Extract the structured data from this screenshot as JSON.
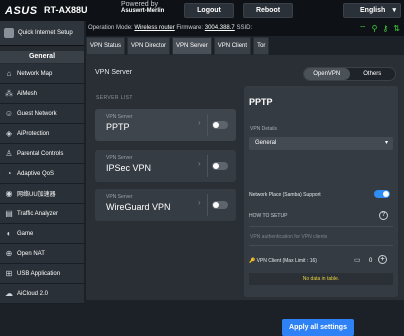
{
  "header": {
    "brand": "ASUS",
    "model": "RT-AX88U",
    "powered_by_label": "Powered by",
    "powered_by_brand": "Asuswrt-Merlin",
    "logout_label": "Logout",
    "reboot_label": "Reboot",
    "language": "English"
  },
  "opbar": {
    "mode_label": "Operation Mode:",
    "mode_value": "Wireless router",
    "firmware_label": "Firmware:",
    "firmware_value": "3004.388.7",
    "ssid_label": "SSID:"
  },
  "sidebar": {
    "qis_label": "Quick Internet Setup",
    "general_label": "General",
    "items": [
      {
        "label": "Network Map",
        "icon": "network-map-icon"
      },
      {
        "label": "AiMesh",
        "icon": "aimesh-icon"
      },
      {
        "label": "Guest Network",
        "icon": "guest-network-icon"
      },
      {
        "label": "AiProtection",
        "icon": "aiprotection-icon"
      },
      {
        "label": "Parental Controls",
        "icon": "parental-controls-icon"
      },
      {
        "label": "Adaptive QoS",
        "icon": "adaptive-qos-icon"
      },
      {
        "label": "网络UU加速器",
        "icon": "uu-accelerator-icon"
      },
      {
        "label": "Traffic Analyzer",
        "icon": "traffic-analyzer-icon"
      },
      {
        "label": "Game",
        "icon": "game-icon"
      },
      {
        "label": "Open NAT",
        "icon": "open-nat-icon"
      },
      {
        "label": "USB Application",
        "icon": "usb-application-icon"
      },
      {
        "label": "AiCloud 2.0",
        "icon": "aicloud-icon"
      }
    ]
  },
  "tabs": [
    {
      "label": "VPN Status"
    },
    {
      "label": "VPN Director"
    },
    {
      "label": "VPN Server"
    },
    {
      "label": "VPN Client"
    },
    {
      "label": "Tor"
    }
  ],
  "main": {
    "title": "VPN Server",
    "seg_openvpn": "OpenVPN",
    "seg_others": "Others",
    "server_list_label": "SERVER LIST",
    "servers": [
      {
        "sub": "VPN Server",
        "name": "PPTP",
        "enabled": false
      },
      {
        "sub": "VPN Server",
        "name": "IPSec VPN",
        "enabled": false
      },
      {
        "sub": "VPN Server",
        "name": "WireGuard VPN",
        "enabled": false
      }
    ]
  },
  "panel": {
    "title": "PPTP",
    "details_label": "VPN Details",
    "details_value": "General",
    "samba_label": "Network Place (Samba) Support",
    "samba_enabled": true,
    "howto_label": "HOW TO SETUP",
    "auth_label": "VPN authentication for VPN clients",
    "client_label": "VPN Client (Max Limit : 16)",
    "client_count": "0",
    "no_data": "No data in table.",
    "apply_label": "Apply all settings"
  },
  "colors": {
    "accent": "#2f82f5",
    "warning": "#e8d23c",
    "status_green": "#3dd33d"
  }
}
